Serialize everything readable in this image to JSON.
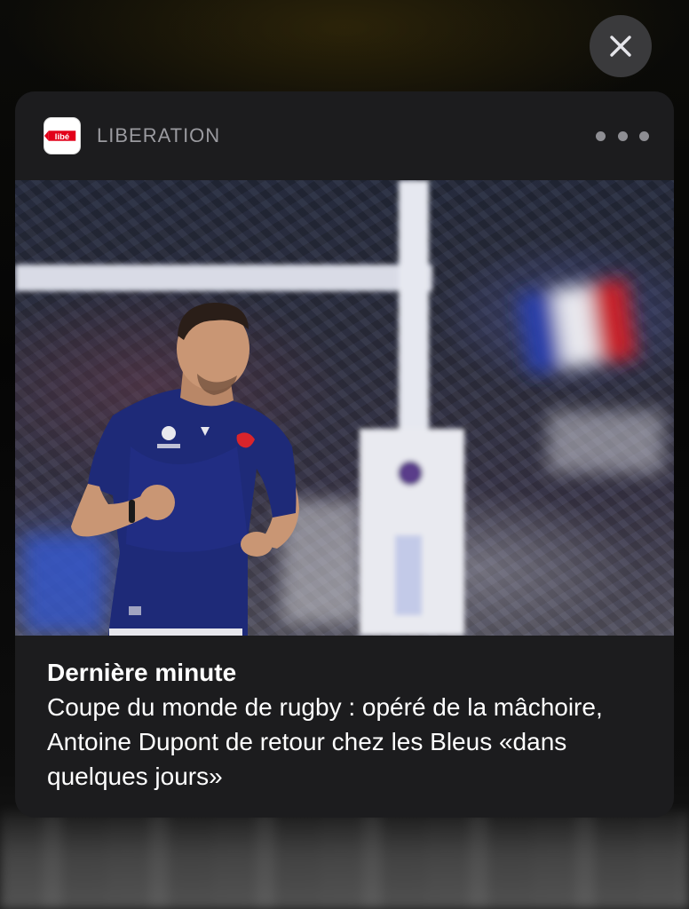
{
  "close_icon": "close-icon",
  "notification": {
    "app_name": "LIBERATION",
    "app_icon": "liberation-app-icon",
    "app_icon_text": "libé",
    "more_icon": "ellipsis-icon",
    "title": "Dernière minute",
    "body": "Coupe du monde de rugby : opéré de la mâchoire, Antoine Dupont de retour chez les Bleus «dans quelques jours»"
  },
  "colors": {
    "card_background": "#1c1c1e",
    "app_name": "#9a9a9f",
    "logo_red": "#e2001a",
    "jersey_blue": "#1e2a78"
  }
}
